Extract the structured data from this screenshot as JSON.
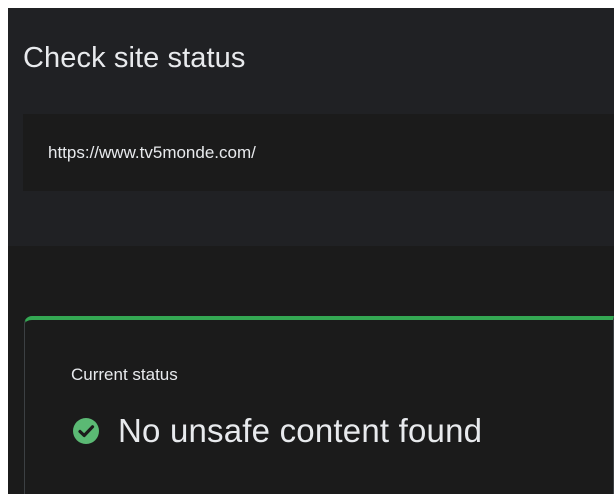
{
  "header": {
    "title": "Check site status"
  },
  "url_input": {
    "value": "https://www.tv5monde.com/"
  },
  "status": {
    "label": "Current status",
    "result": "No unsafe content found",
    "icon": "check-circle-icon",
    "accent_color": "#34a853"
  }
}
